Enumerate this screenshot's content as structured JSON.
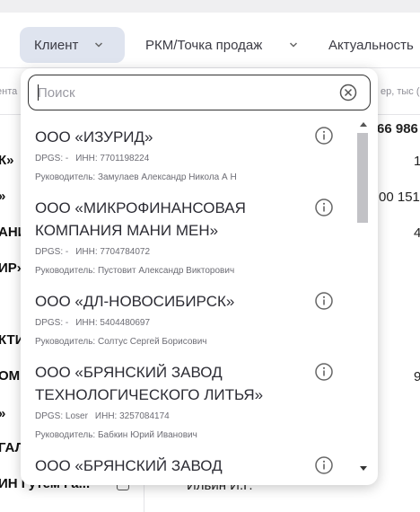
{
  "filters": {
    "client": "Клиент",
    "rkm": "РКМ/Точка продаж",
    "actuality": "Актуальность"
  },
  "background": {
    "col_left_fragment": "ента",
    "col_right_fragment": "ер, тыс (",
    "total": "66 986",
    "row_fragments": [
      "К»",
      "»",
      "АНИ",
      "ИР»",
      "КТИ",
      "ОМ",
      "»",
      "ГАЛ",
      "ИН Гутем Га..."
    ],
    "numbers": [
      "1",
      "00 151",
      "4",
      "9"
    ],
    "bottom_name": "Ильин И.Г."
  },
  "search": {
    "placeholder": "Поиск",
    "value": ""
  },
  "results": [
    {
      "name": "ООО «ИЗУРИД»",
      "dpgs": "DPGS: -",
      "inn": "ИНН: 7701198224",
      "head": "Руководитель: Замулаев Александр Никола А Н"
    },
    {
      "name": "ООО «МИКРОФИНАНСОВАЯ КОМПАНИЯ МАНИ МЕН»",
      "dpgs": "DPGS: -",
      "inn": "ИНН: 7704784072",
      "head": "Руководитель: Пустовит Александр Викторович"
    },
    {
      "name": "ООО «ДЛ-НОВОСИБИРСК»",
      "dpgs": "DPGS: -",
      "inn": "ИНН: 5404480697",
      "head": "Руководитель: Солтус Сергей Борисович"
    },
    {
      "name": "ООО «БРЯНСКИЙ ЗАВОД ТЕХНОЛОГИЧЕСКОГО ЛИТЬЯ»",
      "dpgs": "DPGS: Loser",
      "inn": "ИНН: 3257084174",
      "head": "Руководитель: Бабкин Юрий Иванович"
    },
    {
      "name": "ООО «БРЯНСКИЙ ЗАВОД",
      "dpgs": "",
      "inn": "",
      "head": ""
    }
  ],
  "icons": {
    "chevron": "chevron-down-icon",
    "clear": "clear-circle-x-icon",
    "info": "info-circle-icon"
  },
  "colors": {
    "active_chip": "#dfe4ef",
    "scroll_thumb": "#c2c2c6"
  }
}
